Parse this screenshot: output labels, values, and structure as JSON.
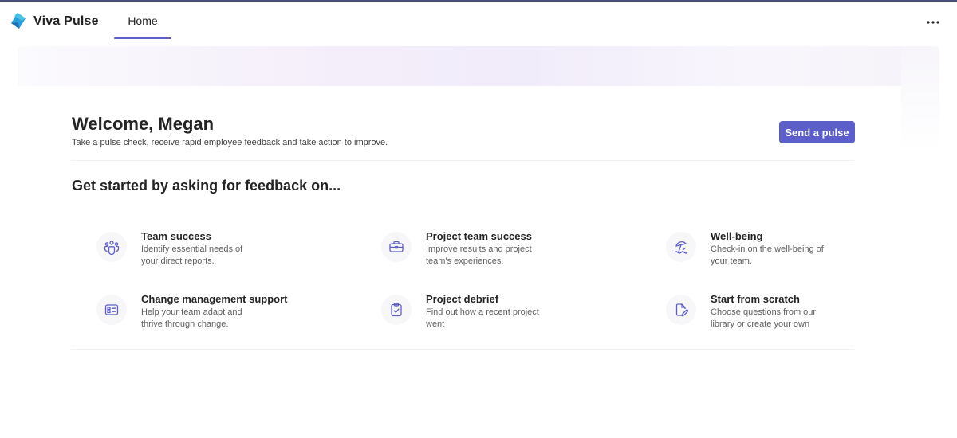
{
  "app": {
    "title": "Viva Pulse",
    "tab": "Home",
    "more_icon": "more-horizontal-icon",
    "accent": "#5b5fc7"
  },
  "welcome": {
    "title": "Welcome, Megan",
    "subtitle": "Take a pulse check, receive rapid employee feedback and take action to improve.",
    "send_button": "Send a pulse"
  },
  "section": {
    "title": "Get started by asking for feedback on..."
  },
  "cards": [
    {
      "title": "Team success",
      "desc": "Identify essential needs of your direct reports.",
      "icon": "people-team-icon"
    },
    {
      "title": "Project team success",
      "desc": "Improve results and project team's experiences.",
      "icon": "briefcase-icon"
    },
    {
      "title": "Well-being",
      "desc": "Check-in on the well-being of your team.",
      "icon": "beach-icon"
    },
    {
      "title": "Change management support",
      "desc": "Help your team adapt and thrive through change.",
      "icon": "board-icon"
    },
    {
      "title": "Project debrief",
      "desc": "Find out how a recent project went",
      "icon": "clipboard-task-icon"
    },
    {
      "title": "Start from scratch",
      "desc": "Choose questions from our library or create your own",
      "icon": "document-edit-icon"
    }
  ]
}
